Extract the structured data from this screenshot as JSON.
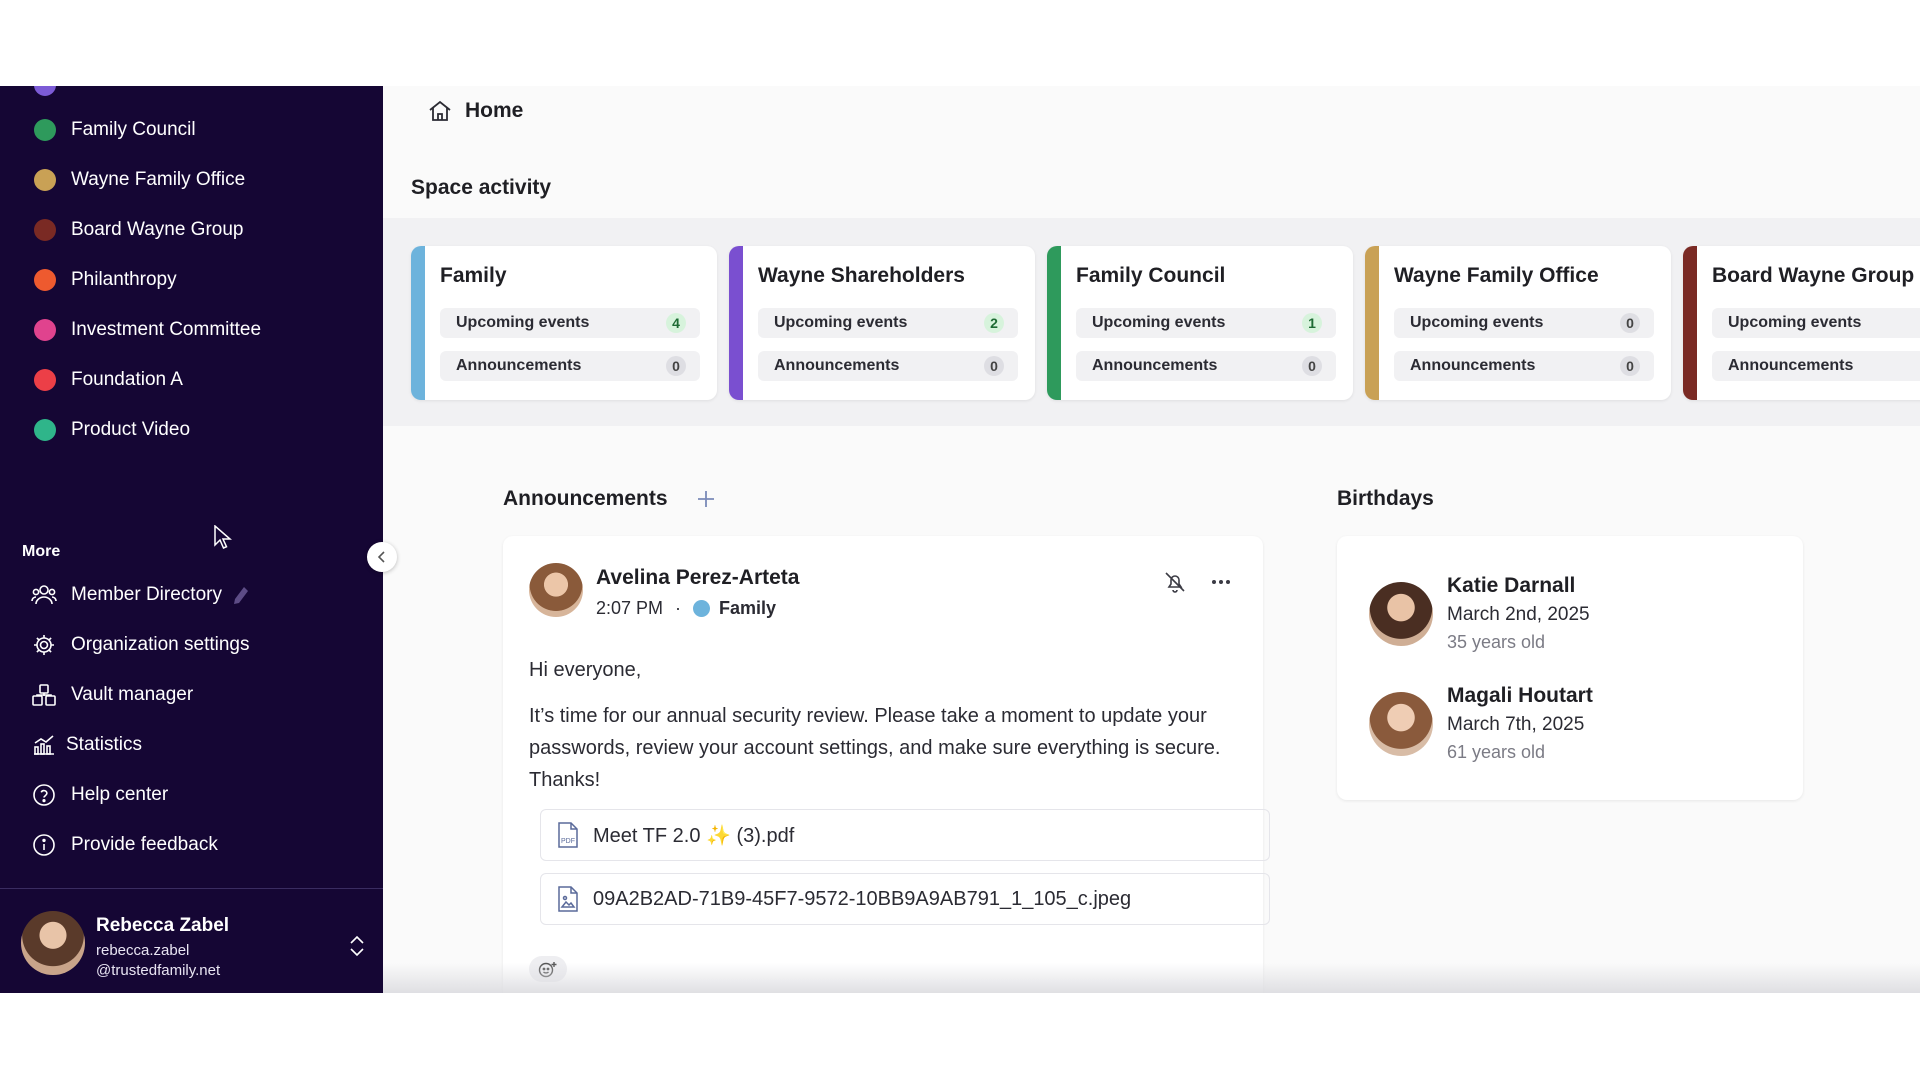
{
  "sidebar": {
    "spaces": [
      {
        "label": "Family Council",
        "color": "#2e9a5c"
      },
      {
        "label": "Wayne Family Office",
        "color": "#c9a155"
      },
      {
        "label": "Board Wayne Group",
        "color": "#7a2a24"
      },
      {
        "label": "Philanthropy",
        "color": "#ee5a2f"
      },
      {
        "label": "Investment Committee",
        "color": "#e0438e"
      },
      {
        "label": "Foundation A",
        "color": "#ec3f47"
      },
      {
        "label": "Product Video",
        "color": "#2fb58a"
      }
    ],
    "more_title": "More",
    "more_items": [
      {
        "label": "Member Directory",
        "icon": "members-icon"
      },
      {
        "label": "Organization settings",
        "icon": "gear-icon"
      },
      {
        "label": "Vault manager",
        "icon": "vault-icon"
      },
      {
        "label": "Statistics",
        "icon": "chart-icon"
      },
      {
        "label": "Help center",
        "icon": "help-icon"
      },
      {
        "label": "Provide feedback",
        "icon": "info-icon"
      }
    ],
    "user": {
      "name": "Rebecca Zabel",
      "email_line1": "rebecca.zabel",
      "email_line2": "@trustedfamily.net"
    }
  },
  "header": {
    "title": "Home",
    "icon": "home-icon"
  },
  "space_activity": {
    "title": "Space activity",
    "cards": [
      {
        "name": "Family",
        "color": "#6db3dc",
        "upcoming_label": "Upcoming events",
        "upcoming": "4",
        "announcements_label": "Announcements",
        "announcements": "0"
      },
      {
        "name": "Wayne Shareholders",
        "color": "#7a4fd0",
        "upcoming_label": "Upcoming events",
        "upcoming": "2",
        "announcements_label": "Announcements",
        "announcements": "0"
      },
      {
        "name": "Family Council",
        "color": "#2e9a5c",
        "upcoming_label": "Upcoming events",
        "upcoming": "1",
        "announcements_label": "Announcements",
        "announcements": "0"
      },
      {
        "name": "Wayne Family Office",
        "color": "#c9a155",
        "upcoming_label": "Upcoming events",
        "upcoming": "0",
        "announcements_label": "Announcements",
        "announcements": "0"
      },
      {
        "name": "Board Wayne Group",
        "color": "#7a2a24",
        "upcoming_label": "Upcoming events",
        "upcoming": "",
        "announcements_label": "Announcements",
        "announcements": ""
      }
    ]
  },
  "announcements": {
    "title": "Announcements",
    "post": {
      "author": "Avelina Perez-Arteta",
      "time": "2:07 PM",
      "separator": "·",
      "space": "Family",
      "space_color": "#6db3dc",
      "body": [
        "Hi everyone,",
        "It’s time for our annual security review. Please take a moment to update your passwords, review your account settings, and make sure everything is secure. Thanks!"
      ],
      "attachments": [
        {
          "name": "Meet TF 2.0 ✨ (3).pdf",
          "icon": "pdf-file-icon"
        },
        {
          "name": "09A2B2AD-71B9-45F7-9572-10BB9A9AB791_1_105_c.jpeg",
          "icon": "image-file-icon"
        }
      ]
    }
  },
  "birthdays": {
    "title": "Birthdays",
    "people": [
      {
        "name": "Katie Darnall",
        "date": "March 2nd, 2025",
        "age": "35 years old"
      },
      {
        "name": "Magali Houtart",
        "date": "March 7th, 2025",
        "age": "61 years old"
      }
    ]
  }
}
